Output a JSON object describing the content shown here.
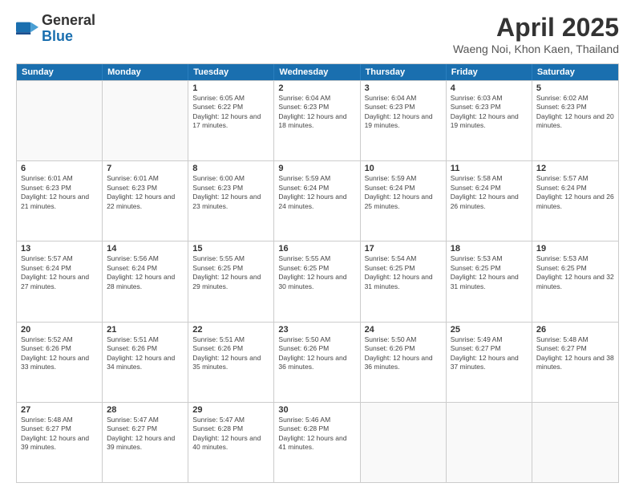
{
  "logo": {
    "general": "General",
    "blue": "Blue"
  },
  "title": "April 2025",
  "subtitle": "Waeng Noi, Khon Kaen, Thailand",
  "days": [
    "Sunday",
    "Monday",
    "Tuesday",
    "Wednesday",
    "Thursday",
    "Friday",
    "Saturday"
  ],
  "weeks": [
    [
      {
        "day": "",
        "info": ""
      },
      {
        "day": "",
        "info": ""
      },
      {
        "day": "1",
        "info": "Sunrise: 6:05 AM\nSunset: 6:22 PM\nDaylight: 12 hours and 17 minutes."
      },
      {
        "day": "2",
        "info": "Sunrise: 6:04 AM\nSunset: 6:23 PM\nDaylight: 12 hours and 18 minutes."
      },
      {
        "day": "3",
        "info": "Sunrise: 6:04 AM\nSunset: 6:23 PM\nDaylight: 12 hours and 19 minutes."
      },
      {
        "day": "4",
        "info": "Sunrise: 6:03 AM\nSunset: 6:23 PM\nDaylight: 12 hours and 19 minutes."
      },
      {
        "day": "5",
        "info": "Sunrise: 6:02 AM\nSunset: 6:23 PM\nDaylight: 12 hours and 20 minutes."
      }
    ],
    [
      {
        "day": "6",
        "info": "Sunrise: 6:01 AM\nSunset: 6:23 PM\nDaylight: 12 hours and 21 minutes."
      },
      {
        "day": "7",
        "info": "Sunrise: 6:01 AM\nSunset: 6:23 PM\nDaylight: 12 hours and 22 minutes."
      },
      {
        "day": "8",
        "info": "Sunrise: 6:00 AM\nSunset: 6:23 PM\nDaylight: 12 hours and 23 minutes."
      },
      {
        "day": "9",
        "info": "Sunrise: 5:59 AM\nSunset: 6:24 PM\nDaylight: 12 hours and 24 minutes."
      },
      {
        "day": "10",
        "info": "Sunrise: 5:59 AM\nSunset: 6:24 PM\nDaylight: 12 hours and 25 minutes."
      },
      {
        "day": "11",
        "info": "Sunrise: 5:58 AM\nSunset: 6:24 PM\nDaylight: 12 hours and 26 minutes."
      },
      {
        "day": "12",
        "info": "Sunrise: 5:57 AM\nSunset: 6:24 PM\nDaylight: 12 hours and 26 minutes."
      }
    ],
    [
      {
        "day": "13",
        "info": "Sunrise: 5:57 AM\nSunset: 6:24 PM\nDaylight: 12 hours and 27 minutes."
      },
      {
        "day": "14",
        "info": "Sunrise: 5:56 AM\nSunset: 6:24 PM\nDaylight: 12 hours and 28 minutes."
      },
      {
        "day": "15",
        "info": "Sunrise: 5:55 AM\nSunset: 6:25 PM\nDaylight: 12 hours and 29 minutes."
      },
      {
        "day": "16",
        "info": "Sunrise: 5:55 AM\nSunset: 6:25 PM\nDaylight: 12 hours and 30 minutes."
      },
      {
        "day": "17",
        "info": "Sunrise: 5:54 AM\nSunset: 6:25 PM\nDaylight: 12 hours and 31 minutes."
      },
      {
        "day": "18",
        "info": "Sunrise: 5:53 AM\nSunset: 6:25 PM\nDaylight: 12 hours and 31 minutes."
      },
      {
        "day": "19",
        "info": "Sunrise: 5:53 AM\nSunset: 6:25 PM\nDaylight: 12 hours and 32 minutes."
      }
    ],
    [
      {
        "day": "20",
        "info": "Sunrise: 5:52 AM\nSunset: 6:26 PM\nDaylight: 12 hours and 33 minutes."
      },
      {
        "day": "21",
        "info": "Sunrise: 5:51 AM\nSunset: 6:26 PM\nDaylight: 12 hours and 34 minutes."
      },
      {
        "day": "22",
        "info": "Sunrise: 5:51 AM\nSunset: 6:26 PM\nDaylight: 12 hours and 35 minutes."
      },
      {
        "day": "23",
        "info": "Sunrise: 5:50 AM\nSunset: 6:26 PM\nDaylight: 12 hours and 36 minutes."
      },
      {
        "day": "24",
        "info": "Sunrise: 5:50 AM\nSunset: 6:26 PM\nDaylight: 12 hours and 36 minutes."
      },
      {
        "day": "25",
        "info": "Sunrise: 5:49 AM\nSunset: 6:27 PM\nDaylight: 12 hours and 37 minutes."
      },
      {
        "day": "26",
        "info": "Sunrise: 5:48 AM\nSunset: 6:27 PM\nDaylight: 12 hours and 38 minutes."
      }
    ],
    [
      {
        "day": "27",
        "info": "Sunrise: 5:48 AM\nSunset: 6:27 PM\nDaylight: 12 hours and 39 minutes."
      },
      {
        "day": "28",
        "info": "Sunrise: 5:47 AM\nSunset: 6:27 PM\nDaylight: 12 hours and 39 minutes."
      },
      {
        "day": "29",
        "info": "Sunrise: 5:47 AM\nSunset: 6:28 PM\nDaylight: 12 hours and 40 minutes."
      },
      {
        "day": "30",
        "info": "Sunrise: 5:46 AM\nSunset: 6:28 PM\nDaylight: 12 hours and 41 minutes."
      },
      {
        "day": "",
        "info": ""
      },
      {
        "day": "",
        "info": ""
      },
      {
        "day": "",
        "info": ""
      }
    ]
  ]
}
